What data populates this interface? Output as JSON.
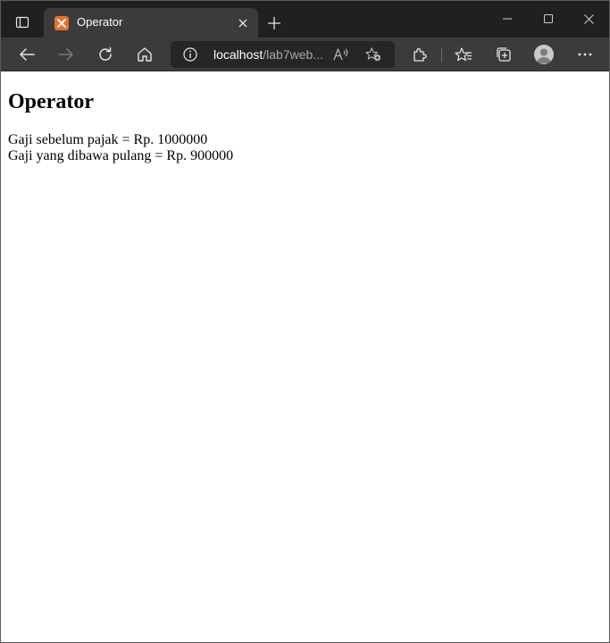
{
  "browser": {
    "tab": {
      "title": "Operator"
    },
    "address": {
      "host": "localhost",
      "path": "/lab7web..."
    },
    "colors": {
      "tabstrip": "#202020",
      "toolbar": "#3b3b3b",
      "favicon": "#e8702a"
    }
  },
  "page": {
    "heading": "Operator",
    "lines": [
      "Gaji sebelum pajak = Rp. 1000000",
      "Gaji yang dibawa pulang = Rp. 900000"
    ]
  }
}
